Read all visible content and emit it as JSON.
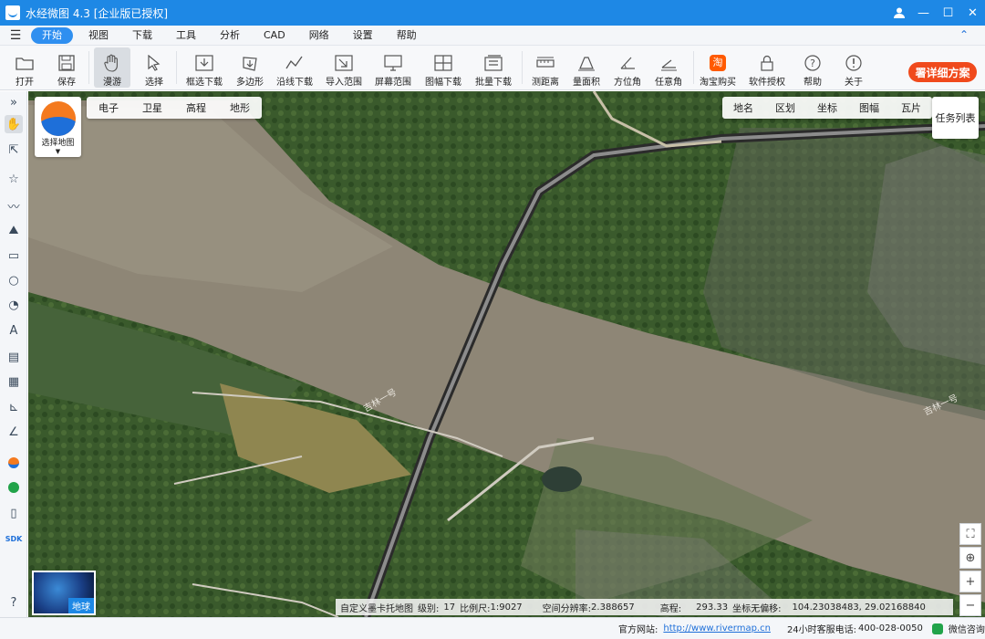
{
  "titlebar": {
    "title": "水经微图 4.3 [企业版已授权]",
    "buttons": [
      "user-icon",
      "minimize-icon",
      "maximize-icon",
      "close-icon"
    ]
  },
  "menu": {
    "items": [
      "开始",
      "视图",
      "下载",
      "工具",
      "分析",
      "CAD",
      "网络",
      "设置",
      "帮助"
    ],
    "active": "开始"
  },
  "toolbar": {
    "items": [
      {
        "label": "打开",
        "icon": "folder-icon"
      },
      {
        "label": "保存",
        "icon": "save-icon"
      },
      {
        "label": "漫游",
        "icon": "hand-icon"
      },
      {
        "label": "选择",
        "icon": "cursor-icon"
      },
      {
        "label": "框选下载",
        "icon": "box-download-icon"
      },
      {
        "label": "多边形",
        "icon": "polygon-download-icon"
      },
      {
        "label": "沿线下载",
        "icon": "line-download-icon"
      },
      {
        "label": "导入范围",
        "icon": "import-icon"
      },
      {
        "label": "屏幕范围",
        "icon": "screen-icon"
      },
      {
        "label": "图幅下载",
        "icon": "grid-icon"
      },
      {
        "label": "批量下载",
        "icon": "batch-icon"
      },
      {
        "label": "测距离",
        "icon": "ruler-icon"
      },
      {
        "label": "量面积",
        "icon": "area-icon"
      },
      {
        "label": "方位角",
        "icon": "azimuth-icon"
      },
      {
        "label": "任意角",
        "icon": "angle-icon"
      },
      {
        "label": "淘宝购买",
        "icon": "taobao-icon"
      },
      {
        "label": "软件授权",
        "icon": "lock-icon"
      },
      {
        "label": "帮助",
        "icon": "help-icon"
      },
      {
        "label": "关于",
        "icon": "info-icon"
      }
    ],
    "active": "漫游",
    "promo": "署详细方案"
  },
  "map": {
    "select_map_label": "选择地图",
    "layer_tabs": [
      "电子",
      "卫星",
      "高程",
      "地形"
    ],
    "overlay_tabs": [
      "地名",
      "区划",
      "坐标",
      "图幅",
      "瓦片"
    ],
    "task_list": "任务列表",
    "globe_label": "地球",
    "road_labels": [
      "吉林一号",
      "吉林一号"
    ],
    "status": {
      "map_name": "自定义墨卡托地图",
      "level_label": "级别:",
      "level": "17",
      "scale_label": "比例尺:",
      "scale": "1:9027",
      "resolution_label": "空间分辨率:",
      "resolution": "2.388657",
      "elevation_label": "高程:",
      "elevation": "293.33",
      "coord_label": "坐标无偏移:",
      "coords": "104.23038483, 29.02168840"
    }
  },
  "statusbar": {
    "site_label": "官方网站:",
    "site_url": "http://www.rivermap.cn",
    "phone_label": "24小时客服电话:",
    "phone": "400-028-0050",
    "wechat": "微信咨询"
  }
}
